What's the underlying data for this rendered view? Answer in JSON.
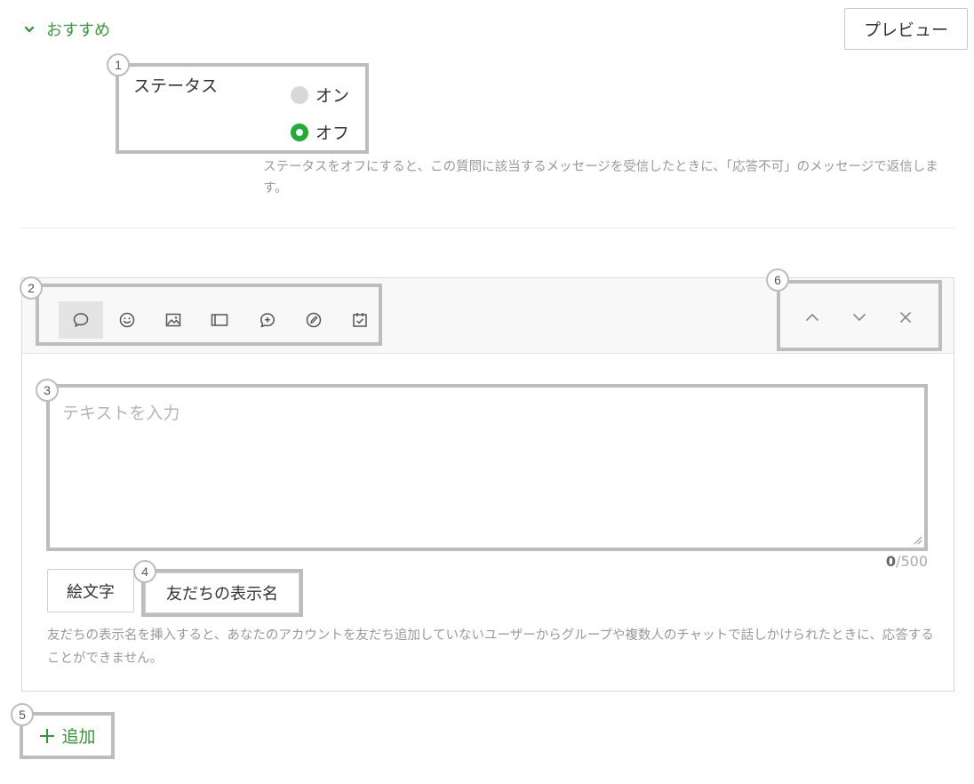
{
  "section": {
    "title": "おすすめ"
  },
  "preview_button": "プレビュー",
  "badges": [
    "1",
    "2",
    "3",
    "4",
    "5",
    "6"
  ],
  "status": {
    "label": "ステータス",
    "options": [
      {
        "label": "オン",
        "selected": false
      },
      {
        "label": "オフ",
        "selected": true
      }
    ],
    "help": "ステータスをオフにすると、この質問に該当するメッセージを受信したときに、「応答不可」のメッセージで返信します。"
  },
  "toolbar": {
    "tools": [
      {
        "icon": "speech-bubble-icon",
        "label": "テキスト",
        "active": true
      },
      {
        "icon": "smiley-icon",
        "label": "スタンプ",
        "active": false
      },
      {
        "icon": "image-icon",
        "label": "画像",
        "active": false
      },
      {
        "icon": "card-icon",
        "label": "カード",
        "active": false
      },
      {
        "icon": "bubble-plus-icon",
        "label": "リッチ",
        "active": false
      },
      {
        "icon": "coupon-icon",
        "label": "クーポン",
        "active": false
      },
      {
        "icon": "calendar-check-icon",
        "label": "予約",
        "active": false
      }
    ],
    "controls": [
      "chevron-up-icon",
      "chevron-down-icon",
      "close-icon"
    ]
  },
  "editor": {
    "placeholder": "テキストを入力",
    "value": "",
    "count": "0",
    "max": "/500"
  },
  "buttons": {
    "emoji": "絵文字",
    "friend_name": "友だちの表示名",
    "add": "追加"
  },
  "friend_name_help": "友だちの表示名を挿入すると、あなたのアカウントを友だち追加していないユーザーからグループや複数人のチャットで話しかけられたときに、応答することができません。",
  "colors": {
    "accent": "#3a9a3a",
    "radio_on": "#1fae35",
    "highlight": "#bdbdbd"
  }
}
